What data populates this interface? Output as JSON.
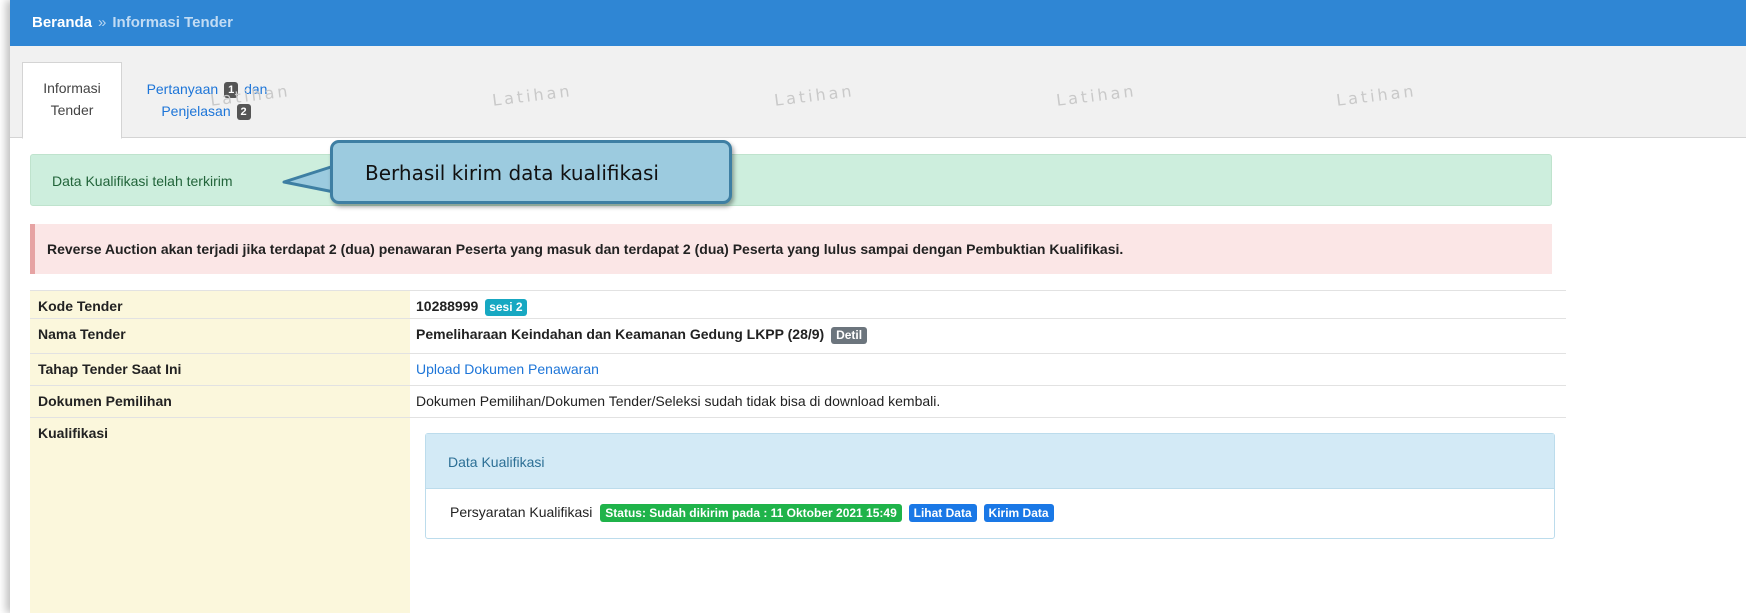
{
  "breadcrumb": {
    "home": "Beranda",
    "separator": "»",
    "current": "Informasi Tender"
  },
  "tabs": {
    "info_line1": "Informasi",
    "info_line2": "Tender",
    "qa_line1_a": "Pertanyaan",
    "qa_badge1": "1",
    "qa_line1_b": "dan",
    "qa_line2": "Penjelasan",
    "qa_badge2": "2"
  },
  "watermarks": [
    "Latihan",
    "Latihan",
    "Latihan",
    "Latihan",
    "Latihan"
  ],
  "alerts": {
    "success": "Data Kualifikasi telah terkirim",
    "callout": "Berhasil kirim data kualifikasi",
    "warning": "Reverse Auction akan terjadi jika terdapat 2 (dua) penawaran Peserta yang masuk dan terdapat 2 (dua) Peserta yang lulus sampai dengan Pembuktian Kualifikasi."
  },
  "table": {
    "kode_label": "Kode Tender",
    "kode_value": "10288999",
    "kode_badge": "sesi 2",
    "nama_label": "Nama Tender",
    "nama_value": "Pemeliharaan Keindahan dan Keamanan Gedung LKPP (28/9)",
    "nama_badge": "Detil",
    "tahap_label": "Tahap Tender Saat Ini",
    "tahap_value": "Upload Dokumen Penawaran",
    "dokumen_label": "Dokumen Pemilihan",
    "dokumen_value": "Dokumen Pemilihan/Dokumen Tender/Seleksi sudah tidak bisa di download kembali.",
    "kualifikasi_label": "Kualifikasi"
  },
  "kualifikasi_panel": {
    "title": "Data Kualifikasi",
    "item_label": "Persyaratan Kualifikasi",
    "status": "Status: Sudah dikirim pada : 11 Oktober 2021 15:49",
    "view_button": "Lihat Data",
    "send_button": "Kirim Data"
  },
  "colors": {
    "topbar": "#2f86d4",
    "success_bg": "#cdeedd",
    "danger_bg": "#fbe6e6",
    "label_bg": "#fbf7dc",
    "callout_bg": "#9ccbdf",
    "link": "#1d75d8"
  }
}
